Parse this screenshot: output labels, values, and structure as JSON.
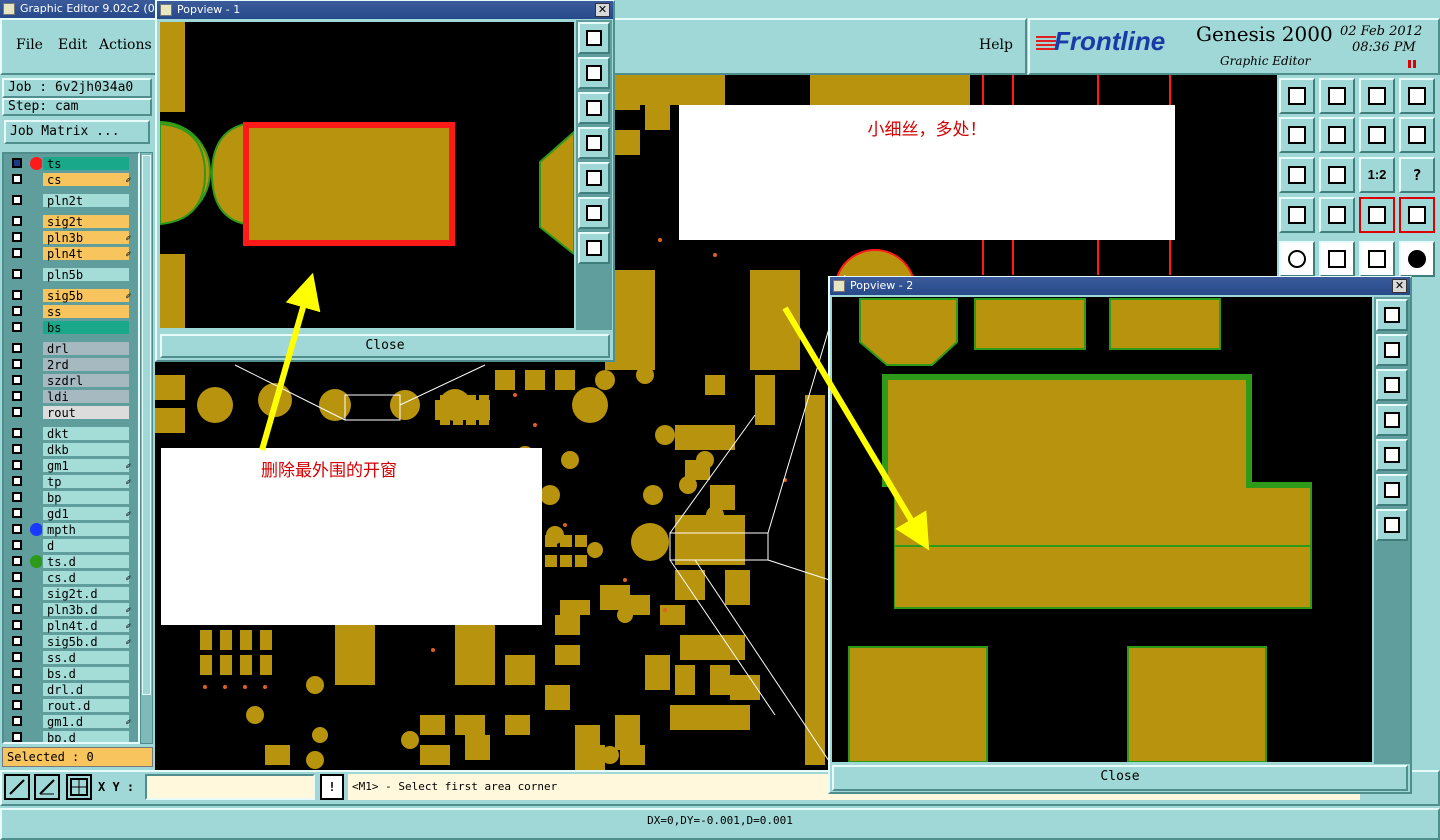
{
  "app": {
    "title": "Graphic Editor 9.02c2 (0",
    "brand": "Frontline",
    "product": "Genesis 2000",
    "subtitle": "Graphic Editor",
    "date": "02 Feb 2012",
    "time": "08:36 PM"
  },
  "menu": {
    "file": "File",
    "edit": "Edit",
    "actions": "Actions",
    "help": "Help"
  },
  "job": {
    "label": "Job : 6v2jh034a0",
    "step": "Step: cam",
    "matrix_button": "Job Matrix ..."
  },
  "layers": [
    {
      "name": "ts",
      "color": "#1aa88a"
    },
    {
      "name": "cs",
      "color": "#f7c45e",
      "flag": "✐"
    },
    {
      "name": "pln2t",
      "color": "#a4dcd8"
    },
    {
      "name": "sig2t",
      "color": "#f7c45e"
    },
    {
      "name": "pln3b",
      "color": "#f7c45e",
      "flag": "✐"
    },
    {
      "name": "pln4t",
      "color": "#f7c45e",
      "flag": "✐"
    },
    {
      "name": "pln5b",
      "color": "#a4dcd8"
    },
    {
      "name": "sig5b",
      "color": "#f7c45e",
      "flag": "✐"
    },
    {
      "name": "ss",
      "color": "#f7c45e"
    },
    {
      "name": "bs",
      "color": "#1aa88a"
    },
    {
      "name": "drl",
      "color": "#a6b8c0"
    },
    {
      "name": "2rd",
      "color": "#a6b8c0"
    },
    {
      "name": "szdrl",
      "color": "#a6b8c0"
    },
    {
      "name": "ldi",
      "color": "#a6b8c0"
    },
    {
      "name": "rout",
      "color": "#dcdcdc"
    },
    {
      "name": "dkt",
      "color": "#a4dcd8"
    },
    {
      "name": "dkb",
      "color": "#a4dcd8"
    },
    {
      "name": "gm1",
      "color": "#a4dcd8",
      "flag": "✐"
    },
    {
      "name": "tp",
      "color": "#a4dcd8",
      "flag": "✐"
    },
    {
      "name": "bp",
      "color": "#a4dcd8"
    },
    {
      "name": "gd1",
      "color": "#a4dcd8",
      "flag": "✐"
    },
    {
      "name": "mpth",
      "color": "#a4dcd8"
    },
    {
      "name": "d",
      "color": "#a4dcd8"
    },
    {
      "name": "ts.d",
      "color": "#a4dcd8"
    },
    {
      "name": "cs.d",
      "color": "#a4dcd8",
      "flag": "✐"
    },
    {
      "name": "sig2t.d",
      "color": "#a4dcd8"
    },
    {
      "name": "pln3b.d",
      "color": "#a4dcd8",
      "flag": "✐"
    },
    {
      "name": "pln4t.d",
      "color": "#a4dcd8",
      "flag": "✐"
    },
    {
      "name": "sig5b.d",
      "color": "#a4dcd8",
      "flag": "✐"
    },
    {
      "name": "ss.d",
      "color": "#a4dcd8"
    },
    {
      "name": "bs.d",
      "color": "#a4dcd8"
    },
    {
      "name": "drl.d",
      "color": "#a4dcd8"
    },
    {
      "name": "rout.d",
      "color": "#a4dcd8"
    },
    {
      "name": "gm1.d",
      "color": "#a4dcd8",
      "flag": "✐"
    },
    {
      "name": "bp.d",
      "color": "#a4dcd8"
    }
  ],
  "selected": "Selected : 0",
  "xy_label": "X Y :",
  "xy_value": "",
  "prompt": "<M1> - Select first area corner",
  "status": "DX=0,DY=-0.001,D=0.001",
  "popview1": {
    "title": "Popview - 1",
    "close": "Close"
  },
  "popview2": {
    "title": "Popview - 2",
    "close": "Close"
  },
  "notes": {
    "top": "小细丝，多处！",
    "left": "删除最外围的开窗"
  },
  "colors": {
    "pad": "#b8930e",
    "board": "#000000",
    "accent_red": "#ff0000",
    "arrow": "#ffff00",
    "outline_green": "#2e9a1a"
  },
  "toolbar_right": {
    "ratio_button": "1:2",
    "help_button": "?"
  }
}
